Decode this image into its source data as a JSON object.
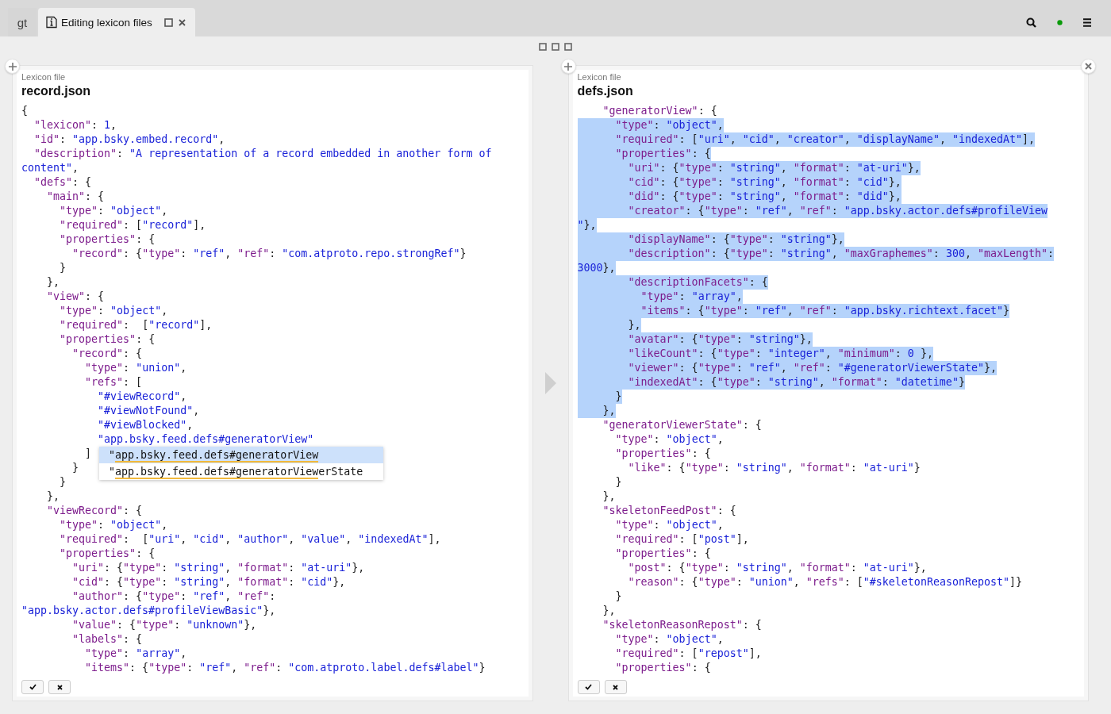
{
  "topbar": {
    "home_tab": {
      "label": "gt"
    },
    "tabs": [
      {
        "label": "Editing lexicon files",
        "selected": true
      }
    ]
  },
  "panels": [
    {
      "subtitle": "Lexicon file",
      "title": "record.json",
      "lines": [
        {
          "text": "{"
        },
        {
          "text": "  \"lexicon\": 1,"
        },
        {
          "text": "  \"id\": \"app.bsky.embed.record\","
        },
        {
          "text": "  \"description\": \"A representation of a record embedded in another form of"
        },
        {
          "text": "content\",",
          "starts_in_string": true
        },
        {
          "text": "  \"defs\": {"
        },
        {
          "text": "    \"main\": {"
        },
        {
          "text": "      \"type\": \"object\","
        },
        {
          "text": "      \"required\": [\"record\"],"
        },
        {
          "text": "      \"properties\": {"
        },
        {
          "text": "        \"record\": {\"type\": \"ref\", \"ref\": \"com.atproto.repo.strongRef\"}"
        },
        {
          "text": "      }"
        },
        {
          "text": "    },"
        },
        {
          "text": "    \"view\": {"
        },
        {
          "text": "      \"type\": \"object\","
        },
        {
          "text": "      \"required\":  [\"record\"],"
        },
        {
          "text": "      \"properties\": {"
        },
        {
          "text": "        \"record\": {"
        },
        {
          "text": "          \"type\": \"union\","
        },
        {
          "text": "          \"refs\": ["
        },
        {
          "text": "            \"#viewRecord\","
        },
        {
          "text": "            \"#viewNotFound\","
        },
        {
          "text": "            \"#viewBlocked\","
        },
        {
          "text": "            \"app.bsky.feed.defs#generatorView\""
        },
        {
          "text": "          ]"
        },
        {
          "text": "        }"
        },
        {
          "text": "      }"
        },
        {
          "text": "    },"
        },
        {
          "text": "    \"viewRecord\": {"
        },
        {
          "text": "      \"type\": \"object\","
        },
        {
          "text": "      \"required\":  [\"uri\", \"cid\", \"author\", \"value\", \"indexedAt\"],"
        },
        {
          "text": "      \"properties\": {"
        },
        {
          "text": "        \"uri\": {\"type\": \"string\", \"format\": \"at-uri\"},"
        },
        {
          "text": "        \"cid\": {\"type\": \"string\", \"format\": \"cid\"},"
        },
        {
          "text": "        \"author\": {\"type\": \"ref\", \"ref\":"
        },
        {
          "text": "\"app.bsky.actor.defs#profileViewBasic\"},"
        },
        {
          "text": "        \"value\": {\"type\": \"unknown\"},"
        },
        {
          "text": "        \"labels\": {"
        },
        {
          "text": "          \"type\": \"array\","
        },
        {
          "text": "          \"items\": {\"type\": \"ref\", \"ref\": \"com.atproto.label.defs#label\"}"
        }
      ],
      "completions": [
        {
          "prefix": "\"",
          "match": "app.bsky.feed.defs#generatorView",
          "selected": true
        },
        {
          "prefix": "\"",
          "match": "app.bsky.feed.defs#generatorView",
          "rest": "erState",
          "selected": false
        }
      ]
    },
    {
      "subtitle": "Lexicon file",
      "title": "defs.json",
      "lines": [
        {
          "text": "    \"generatorView\": {",
          "selected": false
        },
        {
          "text": "      \"type\": \"object\",",
          "selected": true
        },
        {
          "text": "      \"required\": [\"uri\", \"cid\", \"creator\", \"displayName\", \"indexedAt\"],",
          "selected": true
        },
        {
          "text": "      \"properties\": {",
          "selected": true
        },
        {
          "text": "        \"uri\": {\"type\": \"string\", \"format\": \"at-uri\"},",
          "selected": true
        },
        {
          "text": "        \"cid\": {\"type\": \"string\", \"format\": \"cid\"},",
          "selected": true
        },
        {
          "text": "        \"did\": {\"type\": \"string\", \"format\": \"did\"},",
          "selected": true
        },
        {
          "text": "        \"creator\": {\"type\": \"ref\", \"ref\": \"app.bsky.actor.defs#profileView",
          "selected": true
        },
        {
          "text": "\"},",
          "starts_in_string": true,
          "selected": true
        },
        {
          "text": "        \"displayName\": {\"type\": \"string\"},",
          "selected": true
        },
        {
          "text": "        \"description\": {\"type\": \"string\", \"maxGraphemes\": 300, \"maxLength\":",
          "selected": true
        },
        {
          "text": "3000},",
          "selected": true
        },
        {
          "text": "        \"descriptionFacets\": {",
          "selected": true
        },
        {
          "text": "          \"type\": \"array\",",
          "selected": true
        },
        {
          "text": "          \"items\": {\"type\": \"ref\", \"ref\": \"app.bsky.richtext.facet\"}",
          "selected": true
        },
        {
          "text": "        },",
          "selected": true
        },
        {
          "text": "        \"avatar\": {\"type\": \"string\"},",
          "selected": true
        },
        {
          "text": "        \"likeCount\": {\"type\": \"integer\", \"minimum\": 0 },",
          "selected": true
        },
        {
          "text": "        \"viewer\": {\"type\": \"ref\", \"ref\": \"#generatorViewerState\"},",
          "selected": true
        },
        {
          "text": "        \"indexedAt\": {\"type\": \"string\", \"format\": \"datetime\"}",
          "selected": true
        },
        {
          "text": "      }",
          "selected": true
        },
        {
          "text": "    },",
          "selected": true
        },
        {
          "text": "    \"generatorViewerState\": {",
          "selected": false
        },
        {
          "text": "      \"type\": \"object\",",
          "selected": false
        },
        {
          "text": "      \"properties\": {",
          "selected": false
        },
        {
          "text": "        \"like\": {\"type\": \"string\", \"format\": \"at-uri\"}",
          "selected": false
        },
        {
          "text": "      }",
          "selected": false
        },
        {
          "text": "    },",
          "selected": false
        },
        {
          "text": "    \"skeletonFeedPost\": {",
          "selected": false
        },
        {
          "text": "      \"type\": \"object\",",
          "selected": false
        },
        {
          "text": "      \"required\": [\"post\"],",
          "selected": false
        },
        {
          "text": "      \"properties\": {",
          "selected": false
        },
        {
          "text": "        \"post\": {\"type\": \"string\", \"format\": \"at-uri\"},",
          "selected": false
        },
        {
          "text": "        \"reason\": {\"type\": \"union\", \"refs\": [\"#skeletonReasonRepost\"]}",
          "selected": false
        },
        {
          "text": "      }",
          "selected": false
        },
        {
          "text": "    },",
          "selected": false
        },
        {
          "text": "    \"skeletonReasonRepost\": {",
          "selected": false
        },
        {
          "text": "      \"type\": \"object\",",
          "selected": false
        },
        {
          "text": "      \"required\": [\"repost\"],",
          "selected": false
        },
        {
          "text": "      \"properties\": {",
          "selected": false
        }
      ]
    }
  ]
}
